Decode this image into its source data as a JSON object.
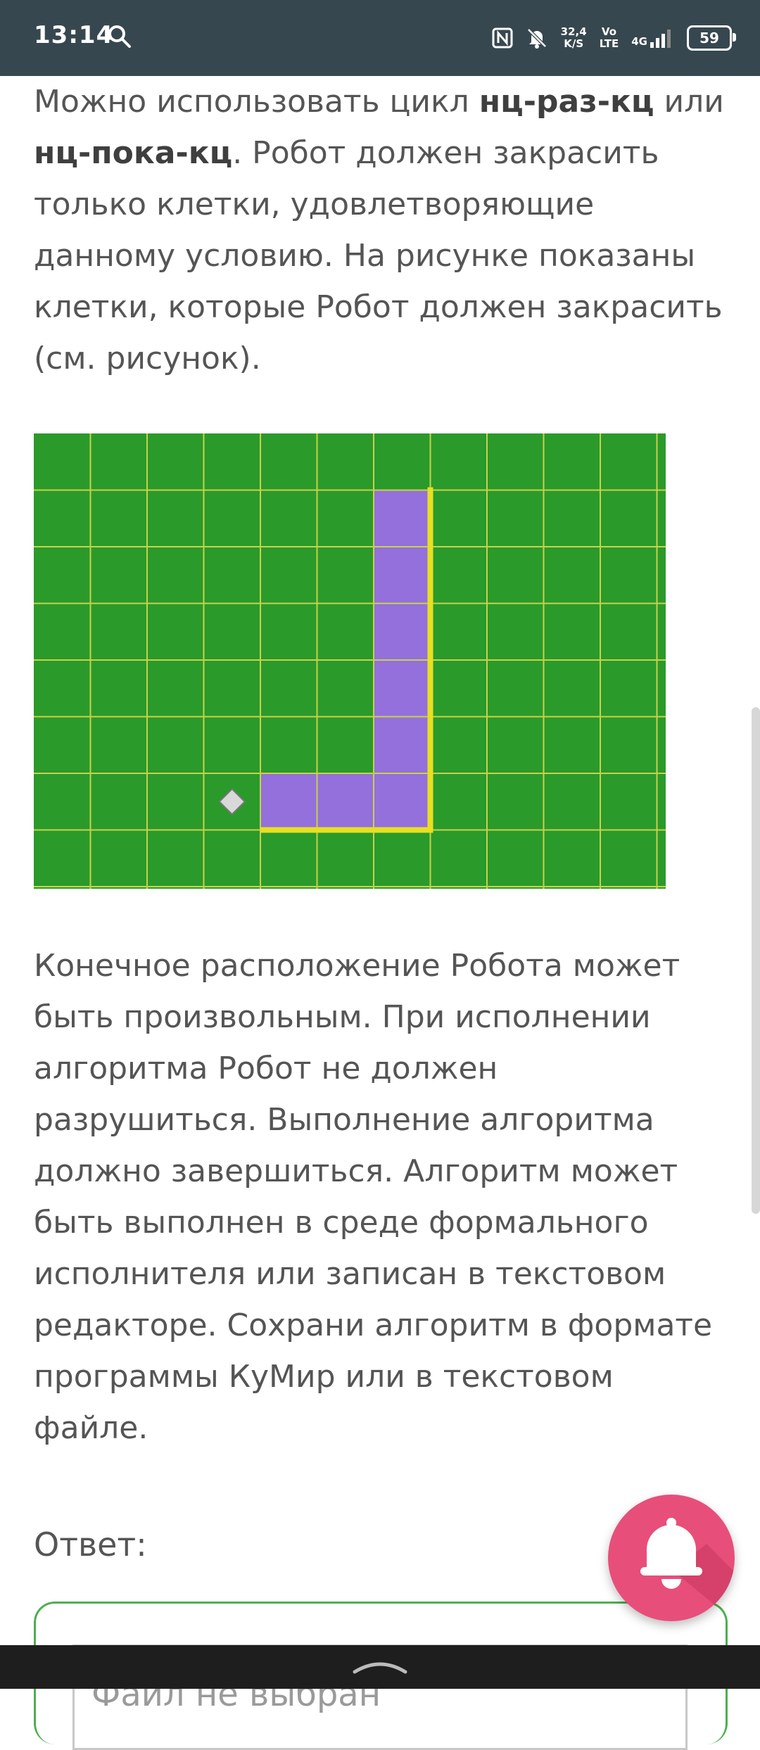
{
  "status_bar": {
    "time": "13:14",
    "net_speed_value": "32,4",
    "net_speed_unit": "K/S",
    "volte_top": "Vo",
    "volte_bottom": "LTE",
    "network": "4G",
    "battery": "59",
    "icons": [
      "search-icon",
      "nfc-icon",
      "mute-bell-icon",
      "signal-icon"
    ]
  },
  "task": {
    "para1_prefix": "Можно использовать цикл ",
    "loop1": "нц-раз-кц",
    "para1_mid": " или ",
    "loop2": "нц-пока-кц",
    "para1_rest": ". Робот должен закрасить только клетки, удовлетворяющие данному условию. На рисунке показаны клетки, которые Робот должен закрасить (см. рисунок).",
    "para2": "Конечное расположение Робота может быть произвольным. При исполнении алгоритма Робот не должен разрушиться. Выполнение алгоритма должно завершиться. Алгоритм может быть выполнен в среде формального исполнителя или записан в текстовом редакторе. Сохрани алгоритм в формате программы КуМир или в текстовом файле."
  },
  "robot_field": {
    "columns": 11,
    "rows": 8,
    "colors": {
      "field": "#2a9a2a",
      "grid": "#c8d24a",
      "wall": "#e8e020",
      "painted": "#9370db",
      "robot": "#d9d9d9"
    },
    "painted_cells": [
      [
        6,
        1
      ],
      [
        6,
        2
      ],
      [
        6,
        3
      ],
      [
        6,
        4
      ],
      [
        6,
        5
      ],
      [
        6,
        6
      ],
      [
        4,
        6
      ],
      [
        5,
        6
      ]
    ],
    "robot_cell": [
      3,
      6
    ]
  },
  "answer": {
    "label": "Ответ:",
    "file_placeholder": "Файл не выбран"
  },
  "fab": {
    "icon": "bell-icon",
    "color": "#e84e7a"
  },
  "nav_bar": {
    "icon": "chevron-up-icon"
  }
}
